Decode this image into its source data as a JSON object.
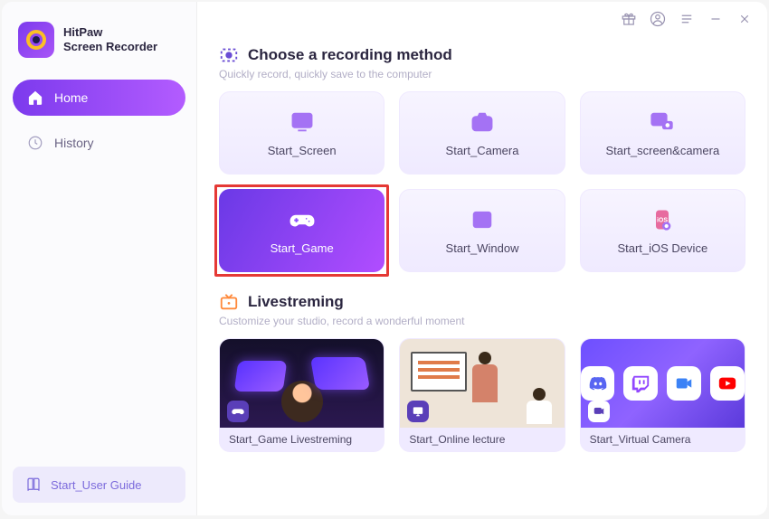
{
  "brand": {
    "line1": "HitPaw",
    "line2": "Screen Recorder"
  },
  "nav": {
    "home": "Home",
    "history": "History"
  },
  "user_guide": "Start_User Guide",
  "section_record": {
    "title": "Choose a recording method",
    "subtitle": "Quickly record, quickly save to the computer",
    "cards": [
      {
        "label": "Start_Screen"
      },
      {
        "label": "Start_Camera"
      },
      {
        "label": "Start_screen&camera"
      },
      {
        "label": "Start_Game"
      },
      {
        "label": "Start_Window"
      },
      {
        "label": "Start_iOS Device"
      }
    ]
  },
  "section_live": {
    "title": "Livestreming",
    "subtitle": "Customize your studio, record a wonderful moment",
    "cards": [
      {
        "label": "Start_Game Livestreming"
      },
      {
        "label": "Start_Online lecture"
      },
      {
        "label": "Start_Virtual Camera"
      }
    ]
  }
}
